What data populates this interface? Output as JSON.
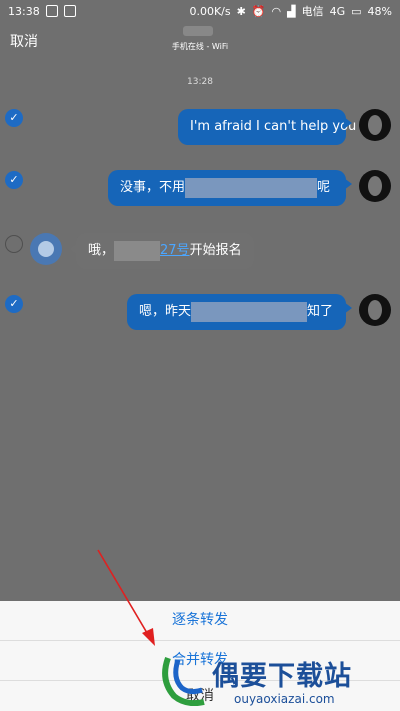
{
  "status_bar": {
    "time": "13:38",
    "speed": "0.00K/s",
    "carrier": "电信",
    "network": "4G",
    "battery": "48%"
  },
  "header": {
    "cancel_label": "取消",
    "subtitle": "手机在线 - WiFi"
  },
  "timestamp": "13:28",
  "messages": [
    {
      "text": "I'm afraid I can't help you"
    },
    {
      "prefix": "没事，不用",
      "suffix": "呢"
    },
    {
      "prefix": "哦，",
      "link": "27号",
      "suffix": "开始报名"
    },
    {
      "prefix": "嗯，昨天",
      "suffix": "知了"
    }
  ],
  "sheet": {
    "item1": "逐条转发",
    "item2": "合并转发",
    "cancel": "取消"
  },
  "watermark": {
    "text": "偶要下载站",
    "url": "ouyaoxiazai.com"
  },
  "colors": {
    "accent": "#1665b8",
    "sheet_text": "#1a74d8",
    "arrow": "#e02020"
  }
}
